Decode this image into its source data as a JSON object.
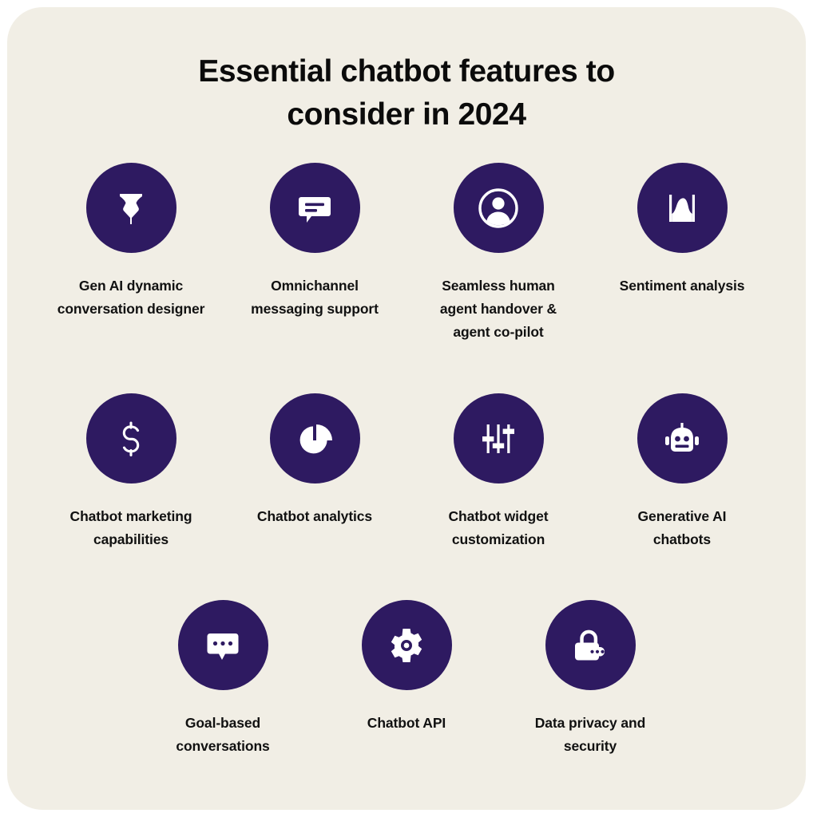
{
  "card": {
    "background_color": "#F1EEE5",
    "page_background_color": "#FFFFFF"
  },
  "title": {
    "line1": "Essential chatbot features to",
    "line2": "consider in 2024",
    "full": "Essential chatbot features to consider in 2024",
    "color": "#0B0B0B"
  },
  "theme": {
    "badge_color": "#2E1A61",
    "icon_color": "#FFFFFF",
    "label_color": "#111111"
  },
  "rows": [
    {
      "items": [
        {
          "icon": "pen-nib-icon",
          "label_line1": "Gen AI dynamic",
          "label_line2": "conversation designer",
          "label_line3": ""
        },
        {
          "icon": "chat-bubble-lines-icon",
          "label_line1": "Omnichannel",
          "label_line2": "messaging support",
          "label_line3": ""
        },
        {
          "icon": "user-circle-icon",
          "label_line1": "Seamless human",
          "label_line2": "agent handover &",
          "label_line3": "agent co-pilot"
        },
        {
          "icon": "area-chart-icon",
          "label_line1": "Sentiment analysis",
          "label_line2": "",
          "label_line3": ""
        }
      ]
    },
    {
      "items": [
        {
          "icon": "dollar-sign-icon",
          "label_line1": "Chatbot marketing",
          "label_line2": "capabilities",
          "label_line3": ""
        },
        {
          "icon": "pie-chart-icon",
          "label_line1": "Chatbot analytics",
          "label_line2": "",
          "label_line3": ""
        },
        {
          "icon": "sliders-icon",
          "label_line1": "Chatbot widget",
          "label_line2": "customization",
          "label_line3": ""
        },
        {
          "icon": "robot-icon",
          "label_line1": "Generative AI",
          "label_line2": "chatbots",
          "label_line3": ""
        }
      ]
    },
    {
      "items": [
        {
          "icon": "chat-bubble-dots-icon",
          "label_line1": "Goal-based",
          "label_line2": "conversations",
          "label_line3": ""
        },
        {
          "icon": "gear-icon",
          "label_line1": "Chatbot API",
          "label_line2": "",
          "label_line3": ""
        },
        {
          "icon": "padlock-password-icon",
          "label_line1": "Data privacy and",
          "label_line2": "security",
          "label_line3": ""
        }
      ]
    }
  ]
}
